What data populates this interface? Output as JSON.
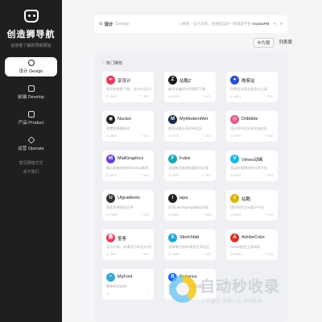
{
  "sidebar": {
    "title": "创造狮导航",
    "subtitle": "创造者了解的导航网站",
    "items": [
      {
        "label": "设计 Design",
        "active": true
      },
      {
        "label": "前端 Develop",
        "active": false
      },
      {
        "label": "产品 Product",
        "active": false
      },
      {
        "label": "运营 Operate",
        "active": false
      }
    ],
    "links": [
      "意见网络方式",
      "关于我们"
    ]
  },
  "topbar": {
    "category": "设计",
    "category_en": "Design",
    "hint_prefix": "UI教程 - 设计灵感、灵感相当的一款调度平台",
    "hint_brand": "AnyvasPM",
    "arrow_left": "<",
    "arrow_right": ">"
  },
  "viewbar": {
    "grid": "卡片版",
    "list": "列表版"
  },
  "panel": {
    "title": "热门推荐"
  },
  "cards": [
    {
      "name": "享设计",
      "desc": "原文化免费下载，设计作品分享",
      "views": "3040",
      "likes": "653",
      "icon_color": "#e8395a",
      "icon_glyph": "∞"
    },
    {
      "name": "站酷Z",
      "desc": "最扣非遍设计师推荐下载",
      "views": "5093",
      "likes": "613",
      "icon_color": "#1a1a1a",
      "icon_glyph": "Z"
    },
    {
      "name": "微客站",
      "desc": "免费设计网全免设计工具",
      "views": "4641",
      "likes": "653",
      "icon_color": "#2c4fcf",
      "icon_glyph": "●"
    },
    {
      "name": "Nucleo",
      "desc": "免费矢量图标库",
      "views": "3983",
      "likes": "573",
      "icon_color": "#222222",
      "icon_glyph": "◉"
    },
    {
      "name": "MyModernMet",
      "desc": "视觉创意分享发布社区",
      "views": "3975",
      "likes": "543",
      "icon_color": "#1b2a4a",
      "icon_glyph": "M"
    },
    {
      "name": "Dribbble",
      "desc": "设计师作品分享交流社区",
      "views": "5870",
      "likes": "543",
      "icon_color": "#e4578b",
      "icon_glyph": "◎"
    },
    {
      "name": "MaliGraphics",
      "desc": "精心收集的样机Mockup素材",
      "views": "5573",
      "likes": "543",
      "icon_color": "#6b3fd4",
      "icon_glyph": "M"
    },
    {
      "name": "Fubiz",
      "desc": "法国每日新潮创意资讯分享",
      "views": "5376",
      "likes": "543",
      "icon_color": "#1aa7b5",
      "icon_glyph": "F"
    },
    {
      "name": "Vimeo动画",
      "desc": "高品质视频创作分享平台",
      "views": "5393",
      "likes": "543",
      "icon_color": "#1ab7ea",
      "icon_glyph": "V"
    },
    {
      "name": "Ulgradients",
      "desc": "渐变色调色板分享",
      "views": "7250",
      "likes": "653",
      "icon_color": "#333333",
      "icon_glyph": "U"
    },
    {
      "name": "lapa",
      "desc": "优秀LandingPage网站灵感",
      "views": "6380",
      "likes": "653",
      "icon_color": "#222222",
      "icon_glyph": "l"
    },
    {
      "name": "站酷",
      "desc": "国内知名设计展示平台",
      "views": "6043",
      "likes": "543",
      "icon_color": "#d9b300",
      "icon_glyph": "z"
    },
    {
      "name": "墨客",
      "desc": "设计分享，充满活力的设计灵感库",
      "views": "4997",
      "likes": "573",
      "icon_color": "#e8395a",
      "icon_glyph": "墨"
    },
    {
      "name": "Sketchfab",
      "desc": "全球最大的3D模型分享社区",
      "views": "3969",
      "likes": "543",
      "icon_color": "#1caad9",
      "icon_glyph": "S"
    },
    {
      "name": "AdobeColor",
      "desc": "Adobe配色工具网站",
      "views": "5030",
      "likes": "543",
      "icon_color": "#d9322c",
      "icon_glyph": "A"
    },
    {
      "name": "MyFont",
      "desc": "最新的字体库",
      "views": "",
      "likes": "",
      "icon_color": "#39a8d6",
      "icon_glyph": "~"
    },
    {
      "name": "Behance",
      "desc": "Adobe旗下设计作品展示",
      "views": "",
      "likes": "",
      "icon_color": "#1769ff",
      "icon_glyph": "B"
    }
  ],
  "watermark": {
    "title": "自动秒收录",
    "subtitle": "-上传提交·来访一次·自动收录-"
  }
}
